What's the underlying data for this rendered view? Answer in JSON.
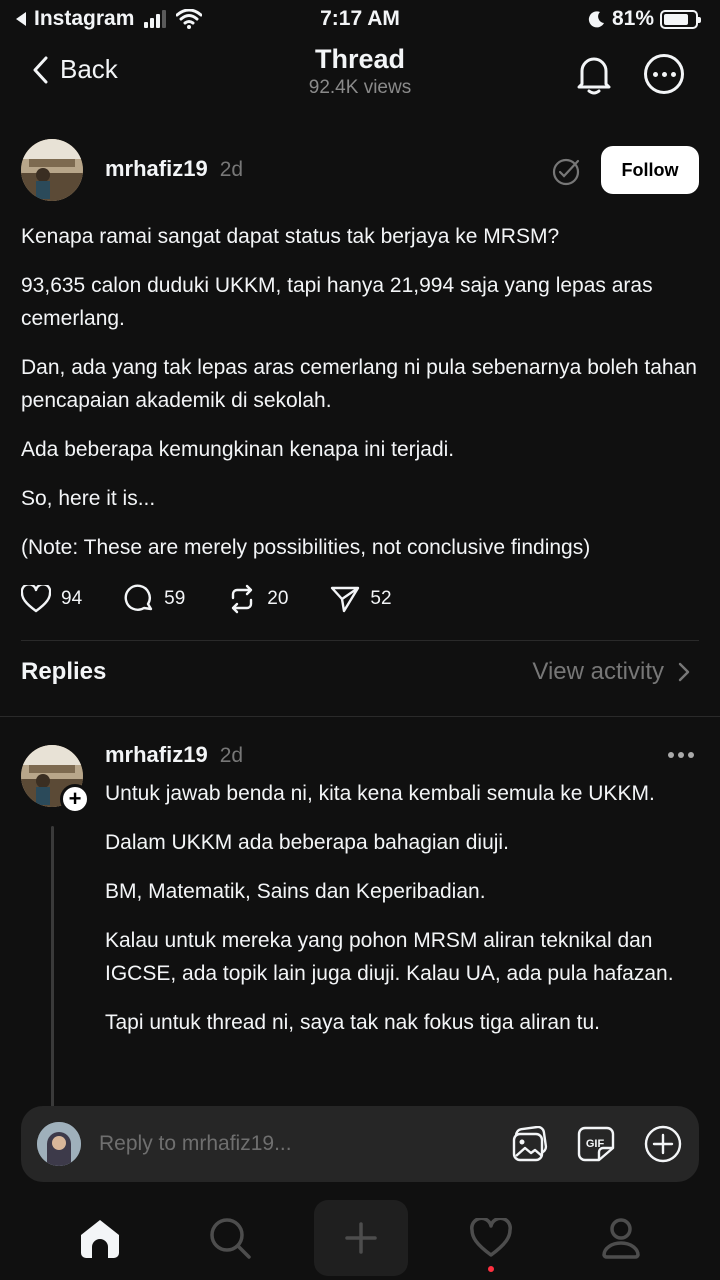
{
  "status_bar": {
    "back_app": "Instagram",
    "time": "7:17 AM",
    "battery": "81%",
    "battery_level": 0.81
  },
  "header": {
    "back_label": "Back",
    "title": "Thread",
    "views": "92.4K views"
  },
  "post": {
    "username": "mrhafiz19",
    "time": "2d",
    "follow_label": "Follow",
    "paragraphs": [
      "Kenapa ramai sangat dapat status tak berjaya ke MRSM?",
      "93,635 calon duduki UKKM, tapi hanya 21,994 saja yang lepas aras cemerlang.",
      "Dan, ada yang tak lepas aras cemerlang ni pula sebenarnya boleh tahan pencapaian akademik di sekolah.",
      "Ada beberapa kemungkinan kenapa ini terjadi.",
      "So, here it is...",
      "(Note: These are merely possibilities, not conclusive findings)"
    ],
    "likes": "94",
    "comments": "59",
    "reposts": "20",
    "shares": "52"
  },
  "replies_section": {
    "title": "Replies",
    "view_activity": "View activity"
  },
  "reply": {
    "username": "mrhafiz19",
    "time": "2d",
    "paragraphs": [
      "Untuk jawab benda ni, kita kena kembali semula ke UKKM.",
      "Dalam UKKM ada beberapa bahagian diuji.",
      "BM, Matematik, Sains dan Keperibadian.",
      "Kalau untuk mereka yang pohon MRSM aliran teknikal dan IGCSE, ada topik lain juga diuji. Kalau UA, ada pula hafazan.",
      "Tapi untuk thread ni, saya tak nak fokus tiga aliran tu."
    ]
  },
  "composer": {
    "placeholder": "Reply to mrhafiz19...",
    "gif_label": "GIF"
  },
  "icons": {
    "back": "chevron-left-icon",
    "bell": "bell-icon",
    "more": "more-icon",
    "verified": "verified-icon",
    "like": "heart-icon",
    "comment": "comment-icon",
    "repost": "repost-icon",
    "share": "send-icon",
    "gallery": "gallery-icon",
    "gif": "gif-icon",
    "add": "plus-circle-icon",
    "home": "home-icon",
    "search": "search-icon",
    "create": "plus-icon",
    "activity": "heart-icon",
    "profile": "profile-icon"
  },
  "colors": {
    "background": "#101010",
    "text": "#f3f5f7",
    "muted": "#777777",
    "notification_dot": "#ff3040"
  }
}
